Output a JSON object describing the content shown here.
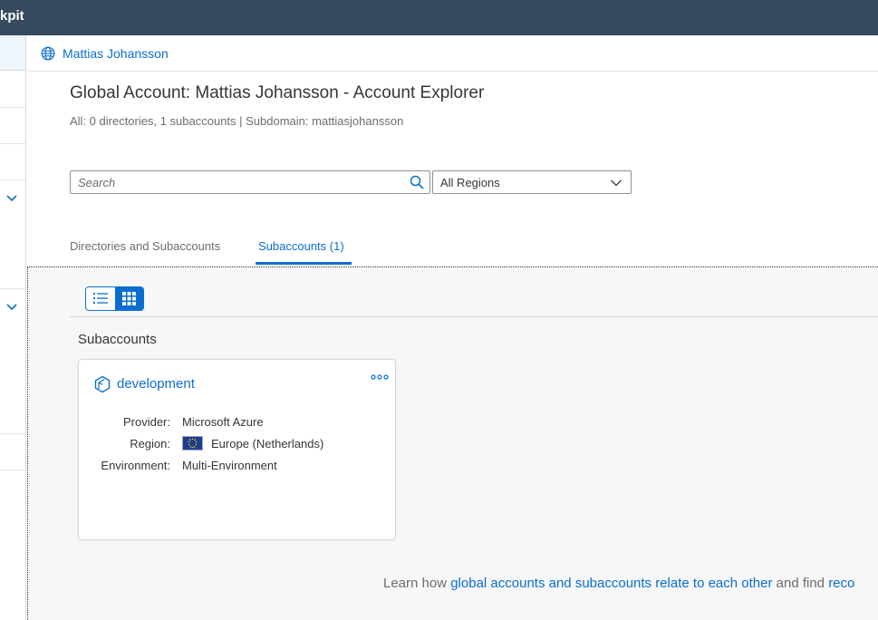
{
  "shell": {
    "title": "kpit"
  },
  "breadcrumb": {
    "account_link": "Mattias Johansson"
  },
  "page": {
    "title": "Global Account: Mattias Johansson - Account Explorer",
    "subtitle": "All: 0 directories, 1 subaccounts | Subdomain: mattiasjohansson"
  },
  "filters": {
    "search_placeholder": "Search",
    "region_select": "All Regions"
  },
  "tabs": [
    {
      "label": "Directories and Subaccounts",
      "active": false
    },
    {
      "label": "Subaccounts (1)",
      "active": true
    }
  ],
  "view_toggle": {
    "options": [
      "list",
      "grid"
    ],
    "selected": "grid"
  },
  "section": {
    "title": "Subaccounts"
  },
  "card": {
    "title": "development",
    "provider_label": "Provider:",
    "provider": "Microsoft Azure",
    "region_label": "Region:",
    "region": "Europe (Netherlands)",
    "environment_label": "Environment:",
    "environment": "Multi-Environment",
    "icons": {
      "title": "subaccount-icon",
      "menu": "more-options-icon",
      "flag": "eu-flag-icon"
    }
  },
  "footer": {
    "prefix": "Learn how ",
    "link1": "global accounts and subaccounts relate to each other",
    "middle": " and find ",
    "link2": "reco"
  },
  "colors": {
    "shell": "#354a5f",
    "accent": "#0a6ed1",
    "text": "#32363a",
    "muted": "#6a6d70",
    "content_bg": "#f7f7f7"
  }
}
